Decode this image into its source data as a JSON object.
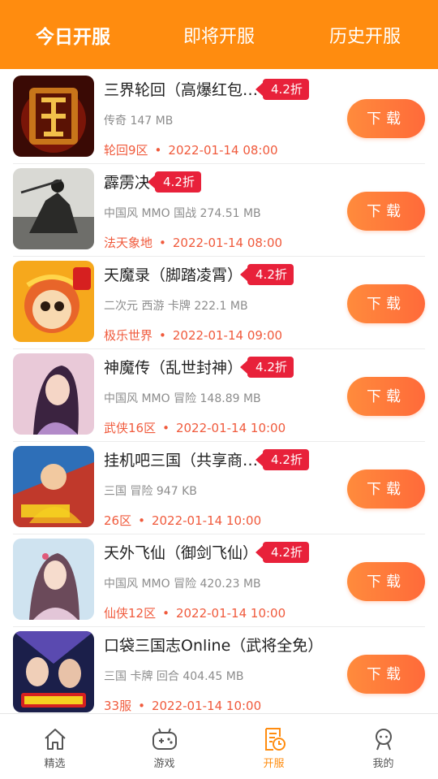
{
  "header": {
    "tabs": [
      {
        "label": "今日开服",
        "active": true
      },
      {
        "label": "即将开服",
        "active": false
      },
      {
        "label": "历史开服",
        "active": false
      }
    ]
  },
  "games": [
    {
      "name": "三界轮回（高爆红包…",
      "discount": "4.2折",
      "meta": "传奇 147 MB",
      "server": "轮回9区",
      "time": "2022-01-14 08:00",
      "download_label": "下载"
    },
    {
      "name": "霹雳决",
      "discount": "4.2折",
      "meta": "中国风 MMO 国战 274.51 MB",
      "server": "法天象地",
      "time": "2022-01-14 08:00",
      "download_label": "下载"
    },
    {
      "name": "天魔录（脚踏凌霄）",
      "discount": "4.2折",
      "meta": "二次元 西游 卡牌 222.1 MB",
      "server": "极乐世界",
      "time": "2022-01-14 09:00",
      "download_label": "下载"
    },
    {
      "name": "神魔传（乱世封神）",
      "discount": "4.2折",
      "meta": "中国风 MMO 冒险 148.89 MB",
      "server": "武侠16区",
      "time": "2022-01-14 10:00",
      "download_label": "下载"
    },
    {
      "name": "挂机吧三国（共享商…",
      "discount": "4.2折",
      "meta": "三国 冒险 947 KB",
      "server": "26区",
      "time": "2022-01-14 10:00",
      "download_label": "下载"
    },
    {
      "name": "天外飞仙（御剑飞仙）",
      "discount": "4.2折",
      "meta": "中国风 MMO 冒险 420.23 MB",
      "server": "仙侠12区",
      "time": "2022-01-14 10:00",
      "download_label": "下载"
    },
    {
      "name": "口袋三国志Online（武将全免）",
      "discount": "",
      "meta": "三国 卡牌 回合 404.45 MB",
      "server": "33服",
      "time": "2022-01-14 10:00",
      "download_label": "下载"
    }
  ],
  "separator": "•",
  "bottom_nav": [
    {
      "label": "精选",
      "icon": "home-icon",
      "active": false
    },
    {
      "label": "游戏",
      "icon": "gamepad-icon",
      "active": false
    },
    {
      "label": "开服",
      "icon": "server-list-icon",
      "active": true
    },
    {
      "label": "我的",
      "icon": "profile-icon",
      "active": false
    }
  ],
  "colors": {
    "accent": "#ff8c0f",
    "badge": "#e8213a",
    "server_text": "#f05a3c"
  }
}
